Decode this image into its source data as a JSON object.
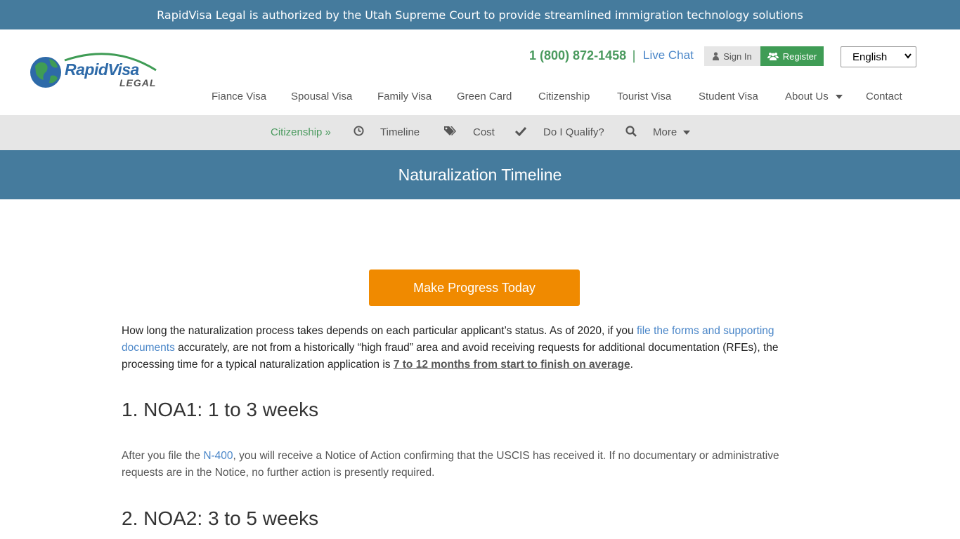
{
  "announcement": "RapidVisa Legal is authorized by the Utah Supreme Court to provide streamlined immigration technology solutions",
  "logo": {
    "name_part1": "Rapid",
    "name_part2": "Visa",
    "sub": "LEGAL"
  },
  "contact": {
    "phone": "1 (800) 872-1458",
    "separator": "|",
    "live_chat": "Live Chat"
  },
  "auth": {
    "sign_in": "Sign In",
    "register": "Register"
  },
  "language": {
    "selected": "English"
  },
  "main_nav": [
    "Fiance Visa",
    "Spousal Visa",
    "Family Visa",
    "Green Card",
    "Citizenship",
    "Tourist Visa",
    "Student Visa",
    "About Us",
    "Contact"
  ],
  "sub_nav": {
    "current": "Citizenship »",
    "timeline": "Timeline",
    "cost": "Cost",
    "qualify": "Do I Qualify?",
    "more": "More"
  },
  "page_title": "Naturalization Timeline",
  "cta": "Make Progress Today",
  "intro": {
    "text1": "How long the naturalization process takes depends on each particular applicant’s status. As of 2020, if you ",
    "link": "file the forms and supporting documents",
    "text2": " accurately, are not from a historically “high fraud” area and avoid receiving requests for additional documentation (RFEs), the processing time for a typical naturalization application is ",
    "emphasis": "7 to 12 months from start to finish on average",
    "text3": "."
  },
  "section1": {
    "heading": "1. NOA1: 1 to 3 weeks",
    "text1": "After you file the ",
    "link": "N-400",
    "text2": ", you will receive a Notice of Action confirming that the USCIS has received it. If no documentary or administrative requests are in the Notice, no further action is presently required."
  },
  "section2": {
    "heading": "2. NOA2: 3 to 5 weeks"
  },
  "colors": {
    "brand_blue": "#457b9d",
    "green": "#4a9a5e",
    "cta_orange": "#f08a00",
    "link_blue": "#4a86c8"
  }
}
